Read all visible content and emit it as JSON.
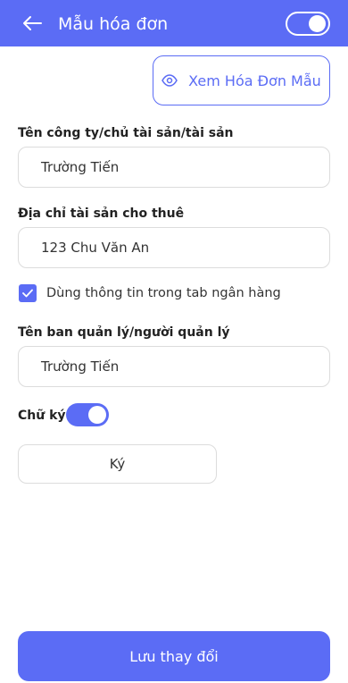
{
  "header": {
    "title": "Mẫu hóa đơn",
    "back_icon": "arrow-left-icon",
    "toggle_on": true
  },
  "preview_button": {
    "label": "Xem Hóa Đơn Mẫu",
    "icon": "eye-icon"
  },
  "fields": {
    "company": {
      "label": "Tên công ty/chủ tài sản/tài sản",
      "value": "Trường Tiến"
    },
    "address": {
      "label": "Địa chỉ tài sản cho thuê",
      "value": "123 Chu Văn An"
    },
    "use_bank_info": {
      "label": "Dùng thông tin trong tab ngân hàng",
      "checked": true
    },
    "manager": {
      "label": "Tên ban quản lý/người quản lý",
      "value": "Trường Tiến"
    }
  },
  "signature": {
    "label": "Chữ ký",
    "toggle_on": true,
    "sign_button_label": "Ký"
  },
  "save_button": {
    "label": "Lưu thay đổi"
  },
  "colors": {
    "accent": "#5b6cf5",
    "border": "#dcdcdc"
  }
}
